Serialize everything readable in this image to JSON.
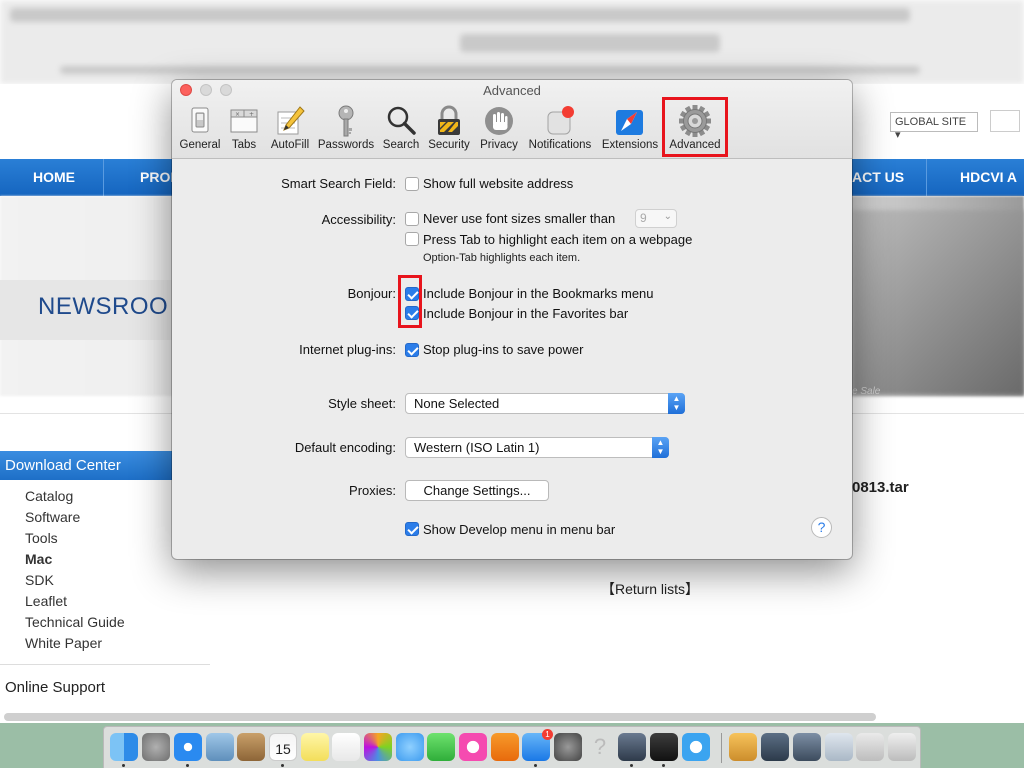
{
  "window": {
    "title": "Advanced"
  },
  "toolbar": {
    "items": [
      {
        "label": "General",
        "icon": "general-switch-icon"
      },
      {
        "label": "Tabs",
        "icon": "tabs-icon"
      },
      {
        "label": "AutoFill",
        "icon": "pencil-icon"
      },
      {
        "label": "Passwords",
        "icon": "key-icon"
      },
      {
        "label": "Search",
        "icon": "magnifier-icon"
      },
      {
        "label": "Security",
        "icon": "padlock-icon"
      },
      {
        "label": "Privacy",
        "icon": "hand-icon"
      },
      {
        "label": "Notifications",
        "icon": "notification-badge-icon"
      },
      {
        "label": "Extensions",
        "icon": "compass-puzzle-icon"
      },
      {
        "label": "Advanced",
        "icon": "gear-icon",
        "selected": true
      }
    ]
  },
  "settings": {
    "smart_search": {
      "label": "Smart Search Field:",
      "option": "Show full website address",
      "checked": false
    },
    "accessibility": {
      "label": "Accessibility:",
      "font_size_option": "Never use font sizes smaller than",
      "font_size_value": "9",
      "font_size_checked": false,
      "tab_option": "Press Tab to highlight each item on a webpage",
      "tab_checked": false,
      "tab_hint": "Option-Tab highlights each item."
    },
    "bonjour": {
      "label": "Bonjour:",
      "bookmarks_option": "Include Bonjour in the Bookmarks menu",
      "bookmarks_checked": true,
      "favorites_option": "Include Bonjour in the Favorites bar",
      "favorites_checked": true
    },
    "plugins": {
      "label": "Internet plug-ins:",
      "option": "Stop plug-ins to save power",
      "checked": true
    },
    "style_sheet": {
      "label": "Style sheet:",
      "value": "None Selected"
    },
    "encoding": {
      "label": "Default encoding:",
      "value": "Western (ISO Latin 1)"
    },
    "proxies": {
      "label": "Proxies:",
      "button": "Change Settings..."
    },
    "develop": {
      "option": "Show Develop menu in menu bar",
      "checked": true
    },
    "help": "?"
  },
  "website": {
    "global_site": "GLOBAL SITE ▾",
    "nav": [
      "HOME",
      "PROD",
      "ACT US",
      "HDCVI A"
    ],
    "newsroom": "NEWSROO",
    "hero_caption": "e Sale",
    "sidebar_title": "Download Center",
    "sidebar_links": [
      "Catalog",
      "Software",
      "Tools",
      "Mac",
      "SDK",
      "Leaflet",
      "Technical Guide",
      "White Paper"
    ],
    "sidebar_active": "Mac",
    "online_support": "Online Support",
    "file_fragment": "0813.tar",
    "return_lists": "【Return lists】"
  },
  "colors": {
    "accent": "#2b7de9",
    "highlight": "#e8141c",
    "nav_blue": "#1565bf"
  },
  "dock": {
    "calendar_day": "15",
    "appstore_badge": "1",
    "icons": [
      "finder-icon",
      "launchpad-icon",
      "safari-icon",
      "preview-icon",
      "contacts-icon",
      "calendar-icon",
      "notes-icon",
      "reminders-icon",
      "photos-icon",
      "messages-icon",
      "facetime-icon",
      "itunes-icon",
      "ibooks-icon",
      "app-store-icon",
      "system-preferences-icon",
      "help-icon",
      "quicktime-icon",
      "terminal-icon",
      "wifi-icon",
      "package-icon",
      "displays-icon",
      "screen-sharing-icon",
      "scanner-icon",
      "network-icon",
      "trash-icon"
    ]
  }
}
